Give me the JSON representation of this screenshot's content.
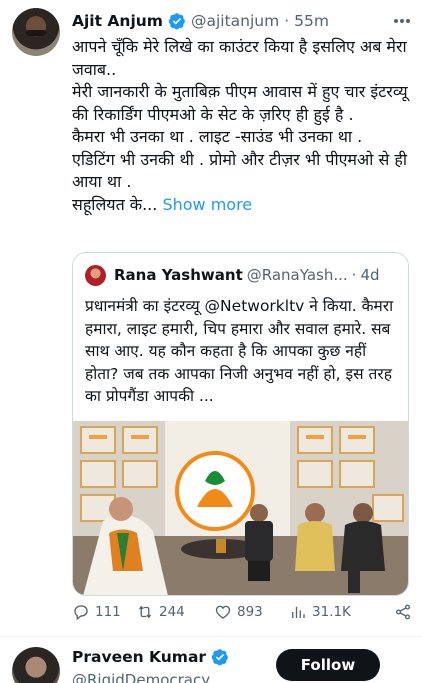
{
  "tweet": {
    "author_name": "Ajit Anjum",
    "author_handle": "@ajitanjum",
    "separator": "·",
    "time": "55m",
    "lines": [
      "आपने चूँकि मेरे लिखे का काउंटर किया है इसलिए अब मेरा जवाब..",
      "मेरी जानकारी के मुताबिक़ पीएम आवास में हुए चार इंटरव्यू की रिकार्डिंग पीएमओ के सेट के ज़रिए ही हुई है .",
      "कैमरा भी उनका था . लाइट -साउंड भी उनका था . एडिटिंग भी उनकी थी . प्रोमो और टीज़र भी पीएमओ से ही आया था ."
    ],
    "truncated_line": "सहूलियत के...",
    "show_more": "Show more"
  },
  "quote": {
    "author_name": "Rana Yashwant",
    "author_handle": "@RanaYash...",
    "separator": "·",
    "time": "4d",
    "text": "प्रधानमंत्री का इंटरव्यू @Networkltv ने किया. कैमरा हमारा, लाइट हमारी, चिप हमारा और सवाल हमारे. सब साथ आए. यह कौन कहता है कि आपका कुछ नहीं होता? जब तक आपका निजी अनुभव नहीं हो, इस तरह का प्रोपगैंडा आपकी ..."
  },
  "actions": {
    "replies": "111",
    "reposts": "244",
    "likes": "893",
    "views": "31.1K"
  },
  "next_tweet": {
    "author_name": "Praveen Kumar",
    "author_handle": "@RigidDemocracy",
    "follow_label": "Follow"
  },
  "colors": {
    "accent": "#1d9bf0",
    "text": "#0f1419",
    "muted": "#536471",
    "border": "#cfd9de"
  },
  "icons": [
    "verified-badge-icon",
    "more-options-icon",
    "reply-icon",
    "repost-icon",
    "like-icon",
    "views-icon",
    "share-icon"
  ]
}
